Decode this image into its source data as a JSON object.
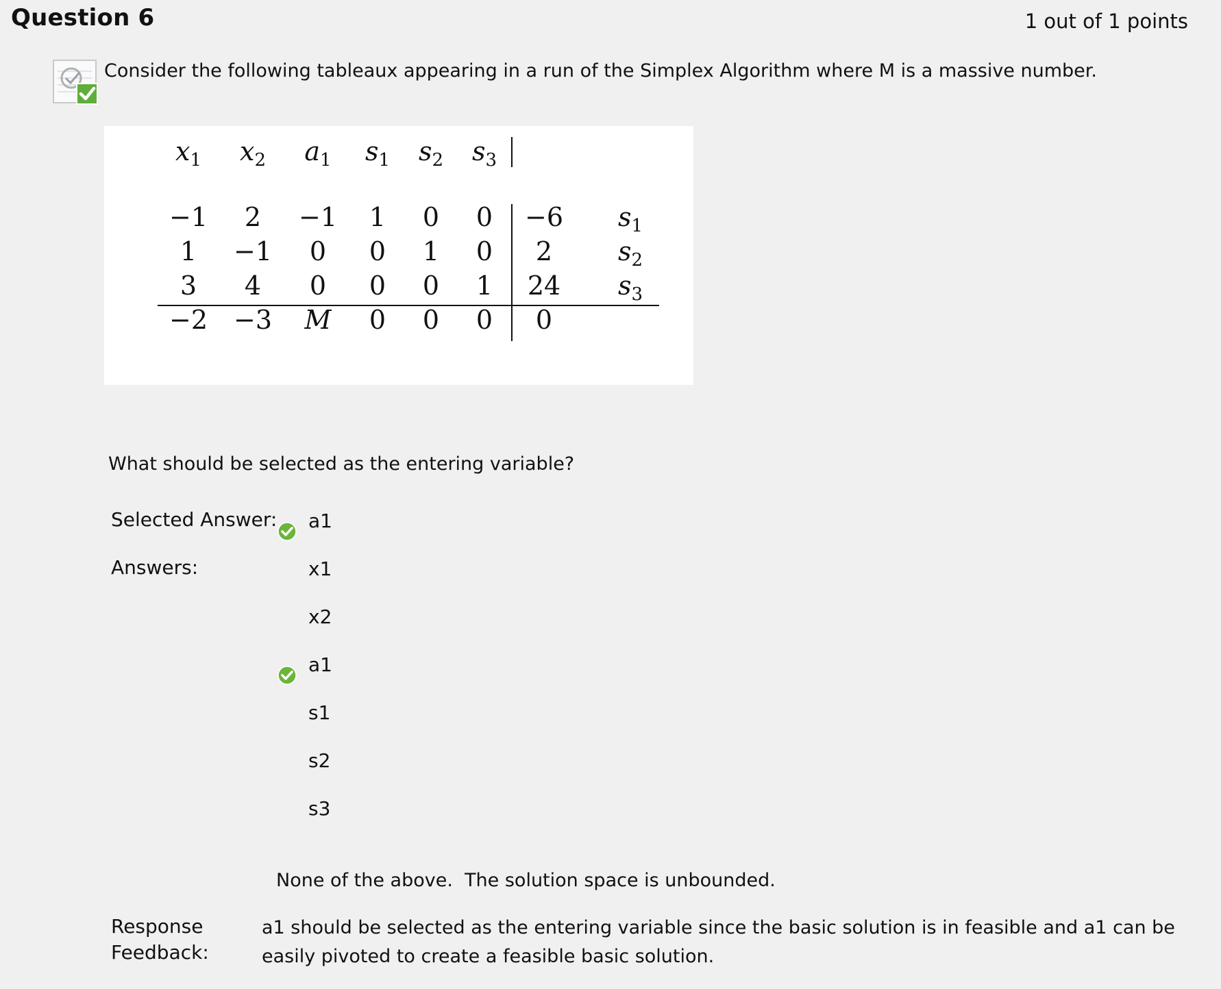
{
  "question": {
    "title": "Question 6",
    "points": "1 out of 1 points",
    "prompt": "Consider the following tableaux appearing in a run of the Simplex Algorithm where M is a massive number.",
    "sub_question": "What should be selected as the entering variable?"
  },
  "tableau": {
    "headers": [
      "x1",
      "x2",
      "a1",
      "s1",
      "s2",
      "s3"
    ],
    "rows": [
      {
        "cells": [
          "−1",
          "2",
          "−1",
          "1",
          "0",
          "0"
        ],
        "rhs": "−6",
        "basic": "s1"
      },
      {
        "cells": [
          "1",
          "−1",
          "0",
          "0",
          "1",
          "0"
        ],
        "rhs": "2",
        "basic": "s2"
      },
      {
        "cells": [
          "3",
          "4",
          "0",
          "0",
          "0",
          "1"
        ],
        "rhs": "24",
        "basic": "s3"
      }
    ],
    "objective": {
      "cells": [
        "−2",
        "−3",
        "M",
        "0",
        "0",
        "0"
      ],
      "rhs": "0"
    }
  },
  "answer": {
    "selected_label": "Selected Answer:",
    "selected_value": "a1",
    "answers_label": "Answers:",
    "options": [
      "x1",
      "x2",
      "a1",
      "s1",
      "s2",
      "s3"
    ],
    "correct_option": "a1",
    "none_of_above": "None of the above.  The solution space is unbounded."
  },
  "feedback": {
    "label_line1": "Response",
    "label_line2": "Feedback:",
    "text": "a1 should be selected as the entering variable since the basic solution is in feasible and a1 can be easily pivoted to create a feasible basic solution."
  },
  "colors": {
    "background": "#f0f0f0",
    "check_green": "#6bb53a"
  },
  "icons": [
    "question-status-icon",
    "correct-check-icon"
  ]
}
